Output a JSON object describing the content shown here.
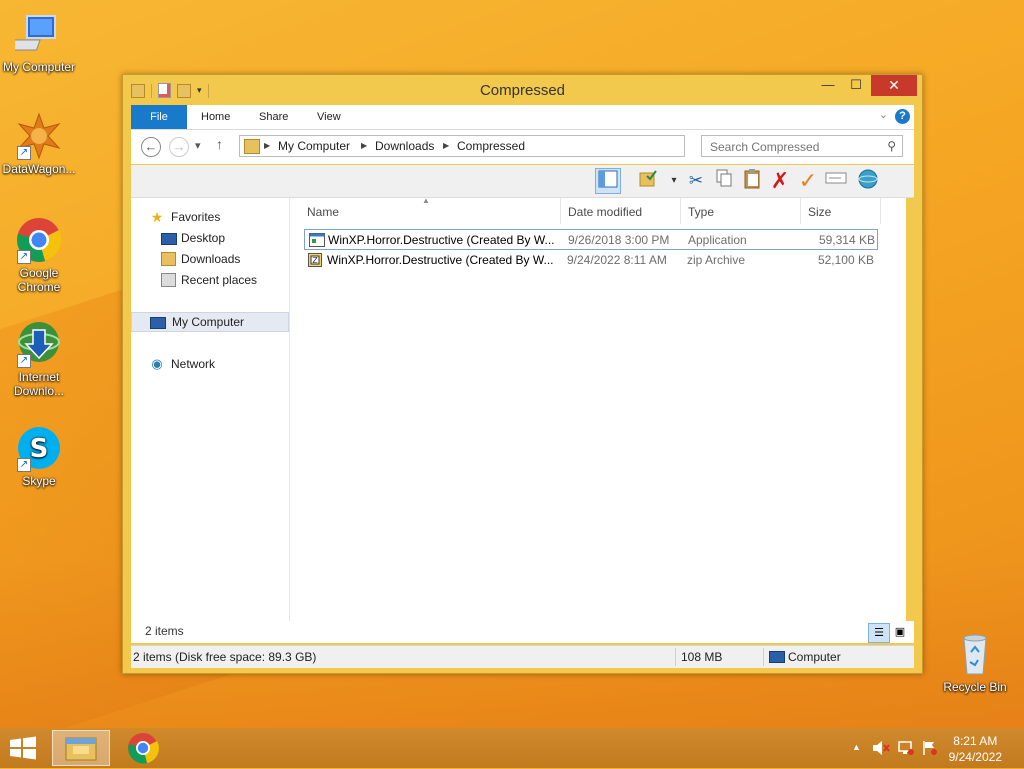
{
  "desktop": {
    "icons": [
      {
        "label": "My Computer",
        "icon": "computer-icon"
      },
      {
        "label": "DataWagon...",
        "icon": "datawagon-icon"
      },
      {
        "label": "Google Chrome",
        "line1": "Google",
        "line2": "Chrome",
        "icon": "chrome-icon"
      },
      {
        "label": "Internet Downlo...",
        "line1": "Internet",
        "line2": "Downlo...",
        "icon": "internet-download-manager-icon"
      },
      {
        "label": "Skype",
        "icon": "skype-icon"
      },
      {
        "label": "Recycle Bin",
        "icon": "recycle-bin-icon"
      }
    ]
  },
  "window": {
    "title": "Compressed",
    "ribbon_tabs": [
      "File",
      "Home",
      "Share",
      "View"
    ],
    "help_label": "?",
    "address": {
      "crumbs": [
        "My Computer",
        "Downloads",
        "Compressed"
      ]
    },
    "search": {
      "placeholder": "Search Compressed"
    },
    "nav_pane": {
      "favorites_label": "Favorites",
      "favorites": [
        "Desktop",
        "Downloads",
        "Recent places"
      ],
      "my_computer": "My Computer",
      "network": "Network"
    },
    "columns": [
      "Name",
      "Date modified",
      "Type",
      "Size"
    ],
    "files": [
      {
        "name": "WinXP.Horror.Destructive  (Created By W...",
        "date": "9/26/2018 3:00 PM",
        "type": "Application",
        "size": "59,314 KB",
        "icon": "application-icon",
        "selected": true
      },
      {
        "name": "WinXP.Horror.Destructive  (Created By W...",
        "date": "9/24/2022 8:11 AM",
        "type": "zip Archive",
        "size": "52,100 KB",
        "icon": "zip-archive-icon",
        "selected": false
      }
    ],
    "item_count": "2 items",
    "statusbar": {
      "summary": "2 items (Disk free space: 89.3 GB)",
      "size": "108 MB",
      "location": "Computer"
    }
  },
  "taskbar": {
    "time": "8:21 AM",
    "date": "9/24/2022"
  },
  "colors": {
    "desktop_bg": "#f5a623",
    "window_frame": "#f2c94c",
    "file_tab": "#1979ca",
    "close_button": "#c7392b"
  }
}
